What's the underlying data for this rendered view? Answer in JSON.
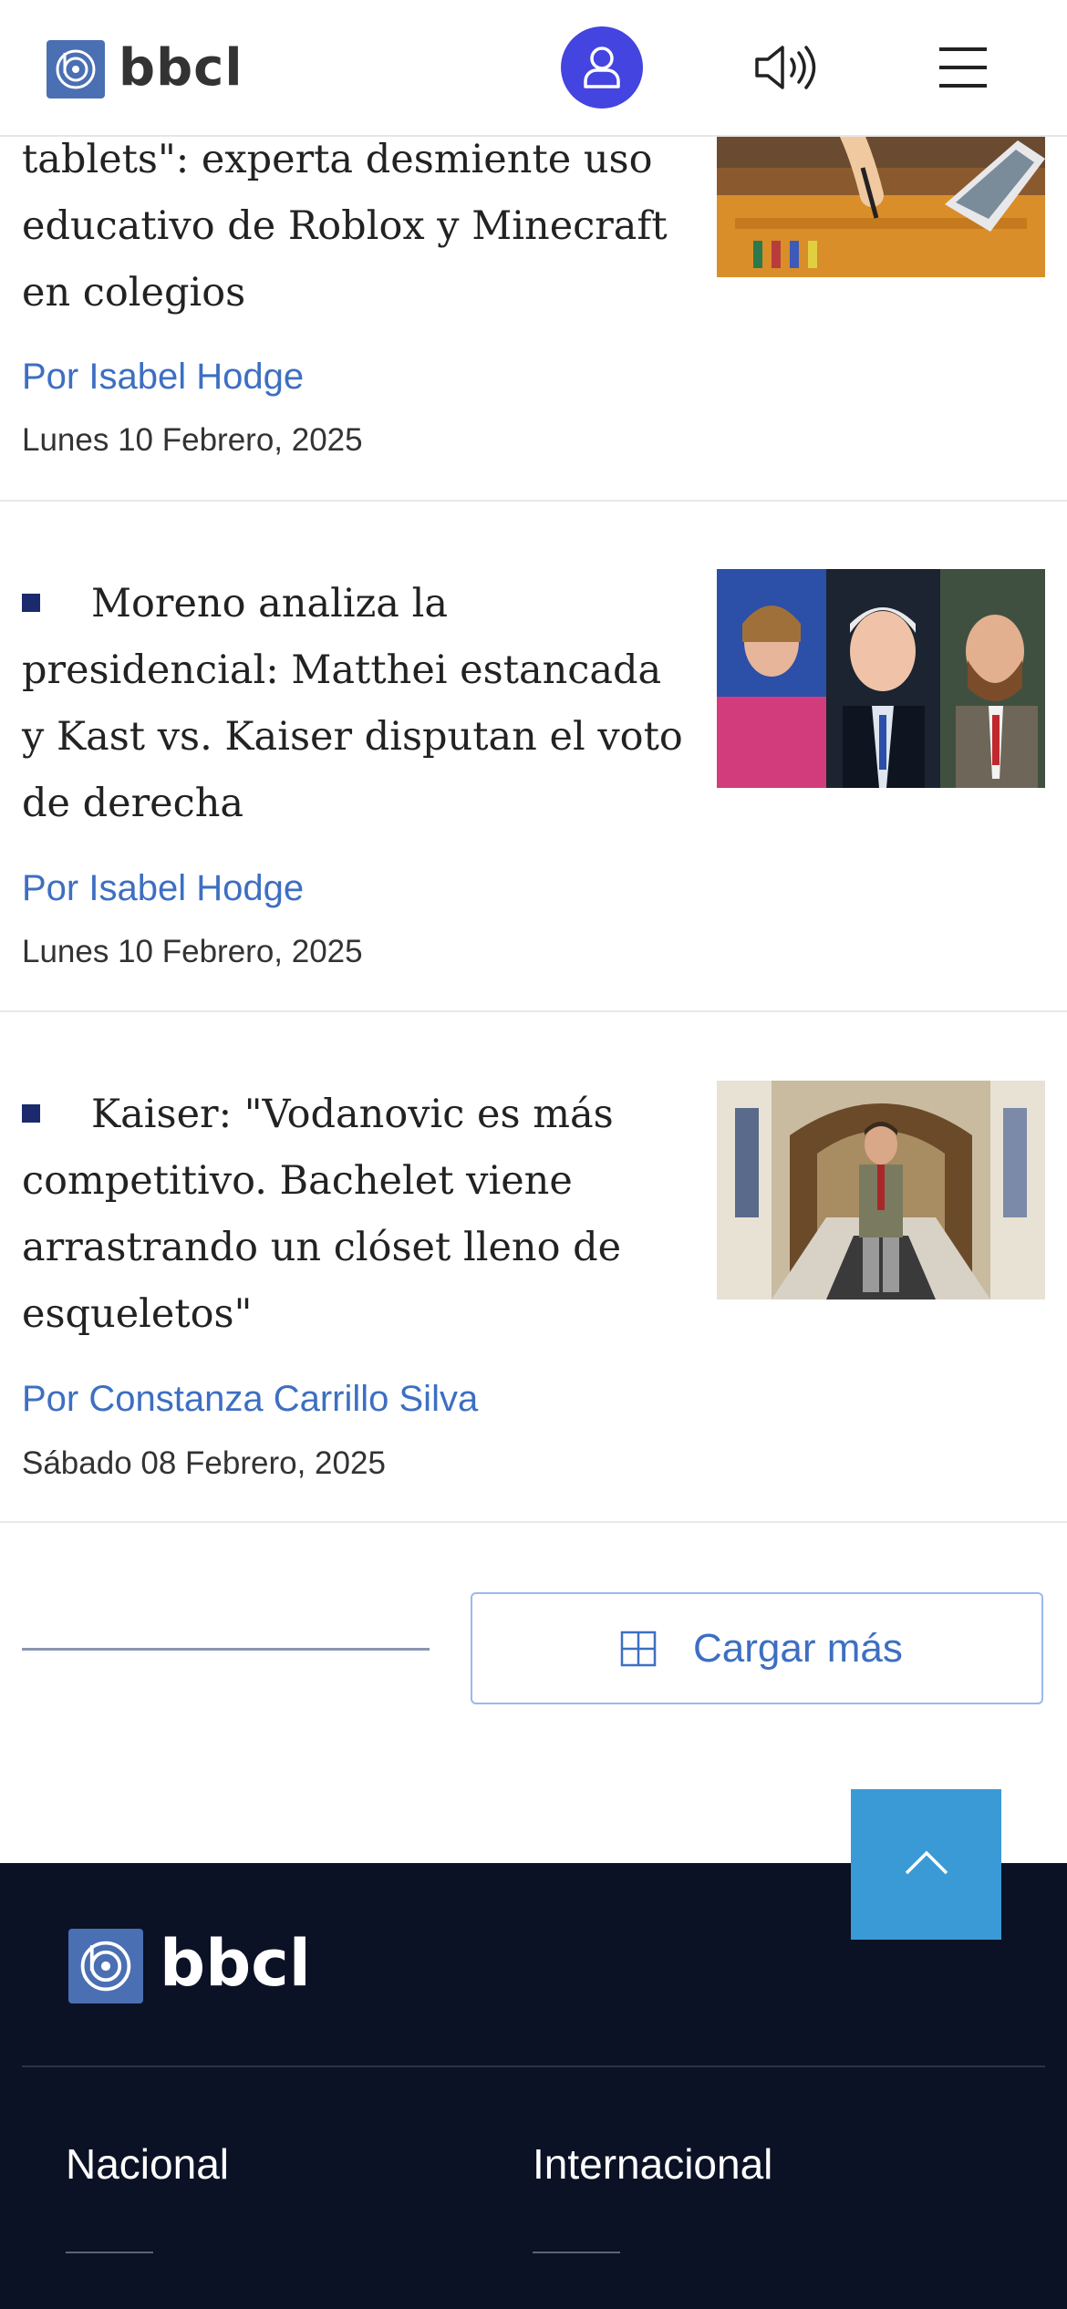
{
  "header": {
    "logo_text": "bbcl",
    "icons": {
      "user": "user-icon",
      "audio": "speaker-icon",
      "menu": "hamburger-menu-icon"
    },
    "colors": {
      "user_button": "#4444e0",
      "logo_box": "#4a6fb3"
    }
  },
  "articles": [
    {
      "title_lines": [
        "tablets\": experta desmiente uso",
        "educativo de Roblox y Minecraft",
        "en colegios"
      ],
      "author": "Por Isabel Hodge",
      "date": "Lunes 10 Febrero, 2025",
      "image": "child-drawing-with-tablet-photo"
    },
    {
      "title_lines": [
        "Moreno analiza la",
        "presidencial: Matthei estancada",
        "y Kast vs. Kaiser disputan el voto",
        "de derecha"
      ],
      "author": "Por Isabel Hodge",
      "date": "Lunes 10 Febrero, 2025",
      "image": "three-politicians-collage-photo"
    },
    {
      "title_lines": [
        "Kaiser: \"Vodanovic es más",
        "competitivo. Bachelet viene",
        "arrastrando un clóset lleno de",
        "esqueletos\""
      ],
      "author": "Por Constanza Carrillo Silva",
      "date": "Sábado 08 Febrero, 2025",
      "image": "man-walking-in-corridor-photo"
    }
  ],
  "load_more": {
    "label": "Cargar más",
    "icon": "plus-icon"
  },
  "scroll_top": {
    "icon": "chevron-up-icon",
    "color": "#3a9ad5"
  },
  "footer": {
    "logo_text": "bbcl",
    "links": [
      "Nacional",
      "Internacional"
    ],
    "background": "#0b1226"
  }
}
